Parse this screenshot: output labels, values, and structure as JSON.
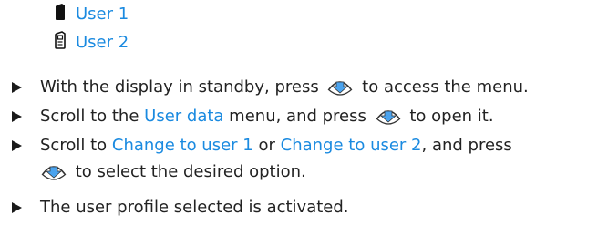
{
  "users": [
    {
      "label": "User 1",
      "icon": "phone-filled-icon"
    },
    {
      "label": "User 2",
      "icon": "phone-outline-icon"
    }
  ],
  "steps": [
    {
      "before": "With the display in standby, press",
      "after": "to access the menu."
    },
    {
      "before": "Scroll to the",
      "link": "User data",
      "middle": "menu, and press",
      "after": "to open it."
    },
    {
      "before": "Scroll to",
      "link1": "Change to user 1",
      "or": "or",
      "link2": "Change to user 2",
      "end": ", and press",
      "line2": "to select the desired option."
    },
    {
      "text": "The user profile selected is activated."
    }
  ],
  "colors": {
    "link": "#1a8ae0",
    "text": "#222222"
  },
  "icons": {
    "nav_key": "navigation-key-icon",
    "bullet": "triangle-bullet-icon"
  }
}
